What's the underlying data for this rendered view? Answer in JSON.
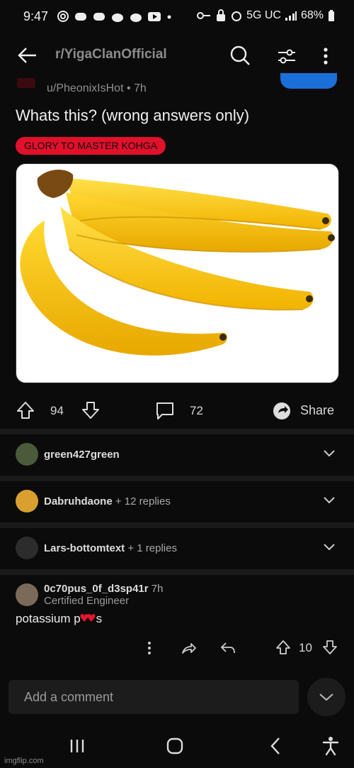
{
  "status_bar": {
    "time": "9:47",
    "network": "5G UC",
    "battery": "68%"
  },
  "app_bar": {
    "subreddit": "r/YigaClanOfficial"
  },
  "post": {
    "author": "u/PheonixIsHot",
    "age": "7h",
    "title": "Whats this? (wrong answers only)",
    "flair": "GLORY TO MASTER KOHGA",
    "flair_color": "#e1102b",
    "upvotes": "94",
    "comments": "72",
    "share_label": "Share"
  },
  "collapsed_comments": [
    {
      "user": "green427green",
      "replies": ""
    },
    {
      "user": "Dabruhdaone",
      "replies": "+ 12 replies"
    },
    {
      "user": "Lars-bottomtext",
      "replies": "+ 1 replies"
    }
  ],
  "comment": {
    "user": "0c70pus_0f_d3sp41r",
    "age": "7h",
    "flair": "Certified Engineer",
    "body_start": "potassium p",
    "body_end": "s",
    "votes": "10"
  },
  "composer": {
    "placeholder": "Add a comment"
  },
  "watermark": "imgflip.com",
  "colors": {
    "accent": "#1a6fd8",
    "background": "#0b0b0b"
  }
}
